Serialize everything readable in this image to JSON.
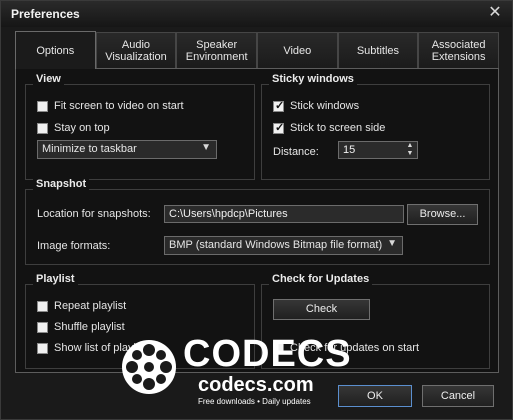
{
  "window": {
    "title": "Preferences",
    "close_glyph": "✕"
  },
  "tabs": [
    {
      "label": "Options",
      "active": true
    },
    {
      "label": "Audio\nVisualization",
      "active": false
    },
    {
      "label": "Speaker\nEnvironment",
      "active": false
    },
    {
      "label": "Video",
      "active": false
    },
    {
      "label": "Subtitles",
      "active": false
    },
    {
      "label": "Associated\nExtensions",
      "active": false
    }
  ],
  "view": {
    "title": "View",
    "fit_screen": {
      "label": "Fit screen to video on start",
      "checked": false
    },
    "stay_on_top": {
      "label": "Stay on top",
      "checked": false
    },
    "minimize_select": {
      "value": "Minimize to taskbar"
    }
  },
  "sticky": {
    "title": "Sticky windows",
    "stick_windows": {
      "label": "Stick windows",
      "checked": true
    },
    "stick_screen_side": {
      "label": "Stick to screen side",
      "checked": true
    },
    "distance_label": "Distance:",
    "distance_value": "15"
  },
  "snapshot": {
    "title": "Snapshot",
    "location_label": "Location for snapshots:",
    "location_value": "C:\\Users\\hpdcp\\Pictures",
    "browse_label": "Browse...",
    "formats_label": "Image formats:",
    "formats_value": "BMP (standard Windows Bitmap file format)"
  },
  "playlist": {
    "title": "Playlist",
    "repeat": {
      "label": "Repeat playlist",
      "checked": false
    },
    "shuffle": {
      "label": "Shuffle playlist",
      "checked": false
    },
    "show_list": {
      "label": "Show list of playlis",
      "checked": false
    }
  },
  "updates": {
    "title": "Check for Updates",
    "check_button": "Check",
    "check_on_start": {
      "label": "Check for updates on start",
      "checked": false
    }
  },
  "buttons": {
    "ok": "OK",
    "cancel": "Cancel"
  },
  "watermark": {
    "main": "CODECS",
    "sub": "codecs.com",
    "small": "Free downloads • Daily updates"
  },
  "icons": {
    "close": "close-icon",
    "dropdown": "chevron-down-icon",
    "spin": "spin-updown-icon",
    "logo": "film-reel-icon"
  }
}
